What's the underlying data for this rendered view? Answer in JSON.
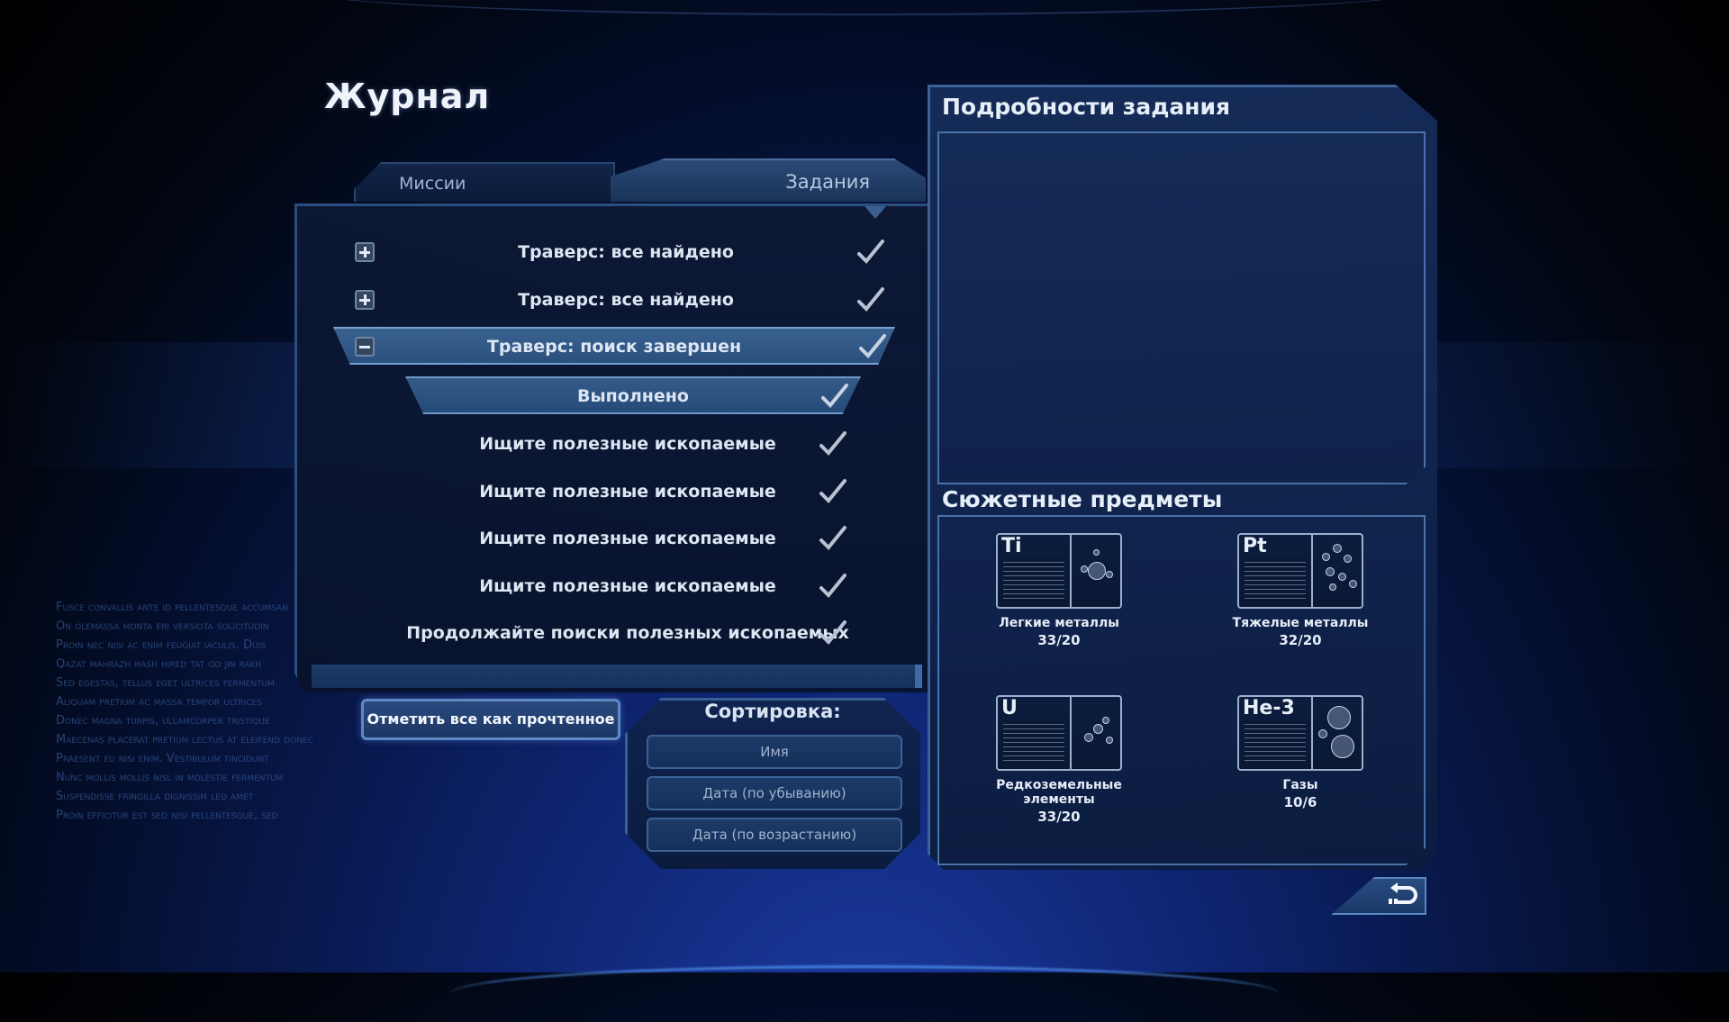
{
  "header": {
    "title": "Журнал"
  },
  "tabs": [
    {
      "label": "Миссии",
      "active": false
    },
    {
      "label": "Задания",
      "active": true
    }
  ],
  "quests": [
    {
      "label": "Траверс: все найдено",
      "expanded": false,
      "completed": true
    },
    {
      "label": "Траверс: все найдено",
      "expanded": false,
      "completed": true
    },
    {
      "label": "Траверс: поиск завершен",
      "expanded": true,
      "completed": true,
      "selected": true
    }
  ],
  "subtasks": [
    {
      "label": "Выполнено",
      "completed": true,
      "selected": true
    },
    {
      "label": "Ищите полезные ископаемые",
      "completed": true
    },
    {
      "label": "Ищите полезные ископаемые",
      "completed": true
    },
    {
      "label": "Ищите полезные ископаемые",
      "completed": true
    },
    {
      "label": "Ищите полезные ископаемые",
      "completed": true
    },
    {
      "label": "Продолжайте поиски полезных ископаемых",
      "completed": true
    }
  ],
  "actions": {
    "mark_all_read": "Отметить все как прочтенное"
  },
  "sort": {
    "title": "Сортировка:",
    "options": [
      "Имя",
      "Дата (по убыванию)",
      "Дата (по возрастанию)"
    ]
  },
  "details": {
    "title": "Подробности задания"
  },
  "story_items": {
    "title": "Сюжетные предметы",
    "items": [
      {
        "symbol": "Ti",
        "name": "Легкие металлы",
        "count": "33/20"
      },
      {
        "symbol": "Pt",
        "name": "Тяжелые металлы",
        "count": "32/20"
      },
      {
        "symbol": "U",
        "name": "Редкоземельные элементы",
        "count": "33/20"
      },
      {
        "symbol": "He-3",
        "name": "Газы",
        "count": "10/6"
      }
    ]
  },
  "background_text": [
    "Fusce convallis ante id pellentesque accumsan",
    "On olemassa monta eri versiota solicitudin",
    "Proin nec nisi ac enim feugiat iaculis. Duis",
    "Qazat mahrazh hash hired tat od jin rakh",
    "Sed egestas, tellus eget ultrices fermentum",
    "Aliquam pretium ac massa tempor ultrices",
    "Donec magna turpis, ullamcorper tristique",
    "Maecenas placerat pretium lectus at eleifend donec",
    "Praesent eu nisi enim. Vestibulum tincidunt",
    "Nunc mollis mollis nisl in molestie fermentum",
    "Suspendisse fringilla dignissim leo amet",
    "Proin efficitur est sed nisi pellentesque, sed"
  ],
  "icons": {
    "expand": "plus-icon",
    "collapse": "minus-icon",
    "completed": "check-icon",
    "back": "back-arrow-icon"
  },
  "colors": {
    "accent": "#5e89c4",
    "panel": "#0f2450",
    "text": "#dde6f2"
  }
}
